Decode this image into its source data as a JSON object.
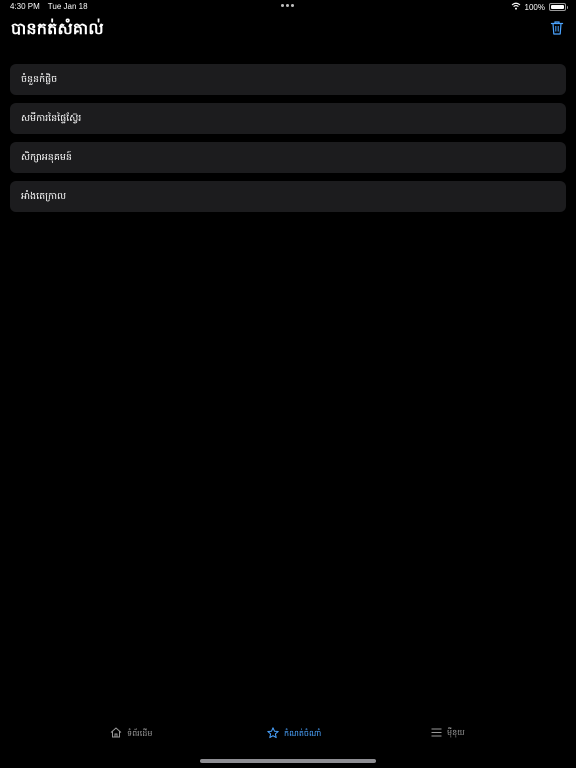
{
  "status_bar": {
    "time": "4:30 PM",
    "date": "Tue Jan 18",
    "battery_percent": "100%",
    "battery_level": 1.0
  },
  "header": {
    "title": "បានកត់សំគាល់",
    "trash_icon": "trash-icon"
  },
  "bookmarks": [
    {
      "label": "ចំនួនកំផ្លិច"
    },
    {
      "label": "សមីការនៃផ្ទៃស្វ៊ែរ"
    },
    {
      "label": "សិក្សាអនុគមន៍"
    },
    {
      "label": "អាំងតេក្រាល"
    }
  ],
  "tab_bar": {
    "tabs": [
      {
        "label": "ទំព័រដើម",
        "icon": "home-icon",
        "active": false
      },
      {
        "label": "កំណត់ចំណាំ",
        "icon": "star-icon",
        "active": true
      },
      {
        "label": "ម៉ឺនុយ",
        "icon": "menu-icon",
        "active": false
      }
    ]
  },
  "colors": {
    "background": "#000000",
    "card": "#1c1c1e",
    "accent": "#4aa3ff",
    "inactive": "#9a9a9a"
  }
}
